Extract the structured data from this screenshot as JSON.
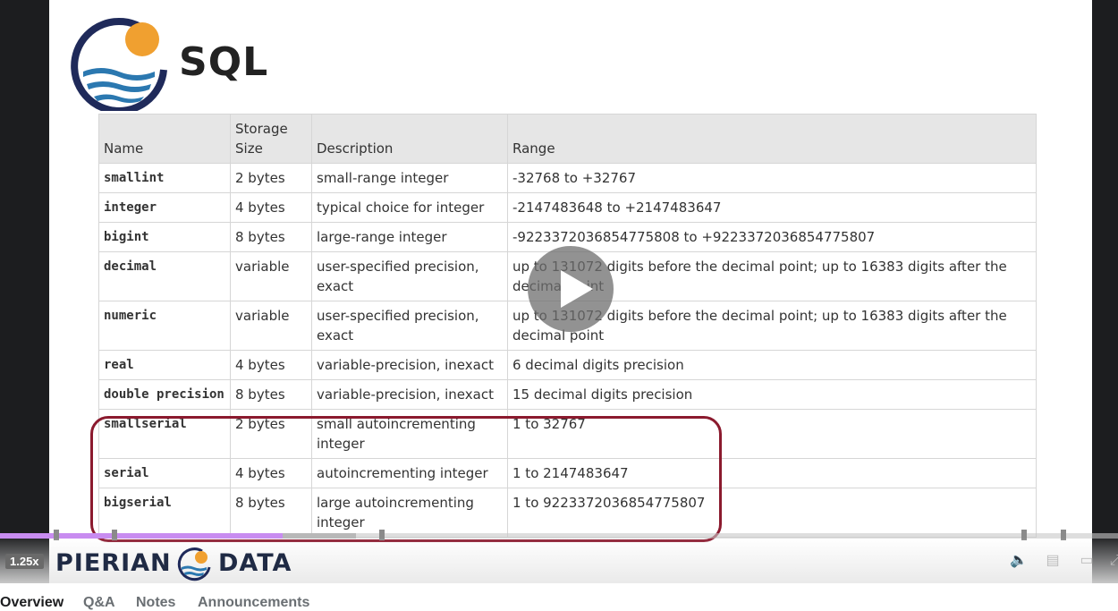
{
  "slide": {
    "logo_text": "SQL",
    "table": {
      "headers": [
        "Name",
        "Storage Size",
        "Description",
        "Range"
      ],
      "rows": [
        {
          "name": "smallint",
          "size": "2 bytes",
          "desc": "small-range integer",
          "range": "-32768 to +32767"
        },
        {
          "name": "integer",
          "size": "4 bytes",
          "desc": "typical choice for integer",
          "range": "-2147483648 to +2147483647"
        },
        {
          "name": "bigint",
          "size": "8 bytes",
          "desc": "large-range integer",
          "range": "-9223372036854775808 to +9223372036854775807"
        },
        {
          "name": "decimal",
          "size": "variable",
          "desc": "user-specified precision, exact",
          "range": "up to 131072 digits before the decimal point; up to 16383 digits after the decimal point"
        },
        {
          "name": "numeric",
          "size": "variable",
          "desc": "user-specified precision, exact",
          "range": "up to 131072 digits before the decimal point; up to 16383 digits after the decimal point"
        },
        {
          "name": "real",
          "size": "4 bytes",
          "desc": "variable-precision, inexact",
          "range": "6 decimal digits precision"
        },
        {
          "name": "double precision",
          "size": "8 bytes",
          "desc": "variable-precision, inexact",
          "range": "15 decimal digits precision"
        },
        {
          "name": "smallserial",
          "size": "2 bytes",
          "desc": "small autoincrementing integer",
          "range": "1 to 32767"
        },
        {
          "name": "serial",
          "size": "4 bytes",
          "desc": "autoincrementing integer",
          "range": "1 to 2147483647"
        },
        {
          "name": "bigserial",
          "size": "8 bytes",
          "desc": "large autoincrementing integer",
          "range": "1 to 9223372036854775807"
        }
      ]
    }
  },
  "player": {
    "speed": "1.25x",
    "brand_left": "PIERIAN",
    "brand_right": "DATA",
    "progress_fraction": 0.253,
    "buffered_fraction": 0.318,
    "icons": [
      "play-icon",
      "volume-icon",
      "transcript-icon",
      "captions-icon",
      "fullscreen-icon"
    ]
  },
  "tabs": [
    "Overview",
    "Q&A",
    "Notes",
    "Announcements"
  ],
  "colors": {
    "highlight": "#8b1a2e",
    "progress": "#c88cf0",
    "logo_orange": "#f0a030",
    "logo_navy": "#1f2a5a",
    "logo_blue": "#2b78b0"
  }
}
